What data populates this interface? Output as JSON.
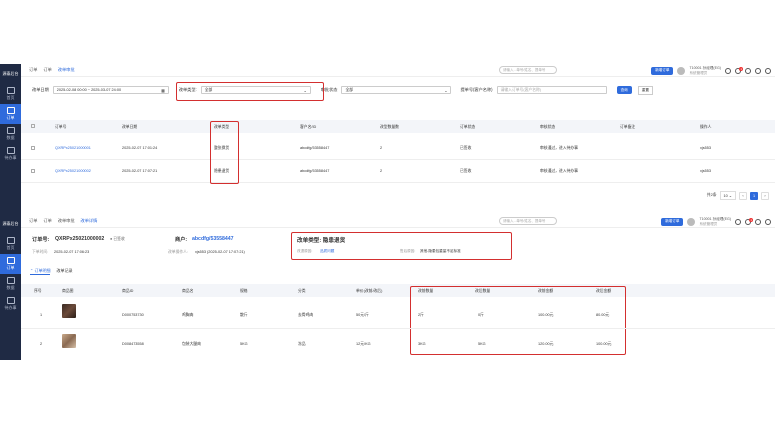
{
  "app": {
    "logo": "源泰后台"
  },
  "sidebar": {
    "items": [
      {
        "label": "首页"
      },
      {
        "label": "订单"
      },
      {
        "label": "数据"
      },
      {
        "label": "待办事"
      }
    ]
  },
  "top1": {
    "crumbs": [
      "订单",
      "订单",
      "改单审批"
    ],
    "search_placeholder": "请输入...单号/姓名、提单号",
    "btn": "新增订单",
    "user_name": "T10001 孙经理(EG)",
    "user_sub": "系统管理员"
  },
  "filters": {
    "date_label": "改单日期",
    "date_value": "2025-02-08 00:00 ~ 2025-03-07 24:00",
    "type_label": "改单类型:",
    "type_value": "全部",
    "audit_label": "审批状态",
    "audit_value": "全部",
    "order_label": "提单号(客户名称)",
    "order_placeholder": "请输入订单号(客户名称)",
    "search_btn": "查询",
    "reset_btn": "重置"
  },
  "list": {
    "headers": [
      "订单号",
      "改单日期",
      "改单类型",
      "客户名/ID",
      "改型数量数",
      "订单状态",
      "审核状态",
      "订单备注",
      "操作人"
    ],
    "rows": [
      {
        "order": "QXRPx25021000001",
        "date": "2025-02-07 17:01:24",
        "type": "整张换货",
        "customer": "abcdfg/53558447",
        "qty": "2",
        "status": "已签收",
        "audit": "审核通过，进入待办事",
        "remark": "",
        "op": "xjs553"
      },
      {
        "order": "QXRPx25021000002",
        "date": "2025-02-07 17:07:21",
        "type": "隐患退货",
        "customer": "abcdfg/53558447",
        "qty": "2",
        "status": "已签收",
        "audit": "审核通过，进入待办事",
        "remark": "",
        "op": "xjs553"
      }
    ],
    "pager": {
      "total": "共2条",
      "size": "10",
      "page": "1"
    }
  },
  "top2": {
    "crumbs": [
      "订单",
      "订单",
      "改单审批",
      "改单详情"
    ],
    "search_placeholder": "请输入...单号/姓名、提单号",
    "btn": "新增订单",
    "user_name": "T10001 孙经理(EG)",
    "user_sub": "系统管理员"
  },
  "detail": {
    "order_label": "订单号:",
    "order_no": "QXRPx25021000002",
    "status": "● 已签收",
    "customer_label": "商户:",
    "customer": "abcdfg/53558447",
    "meta1_label": "下单时间:",
    "meta1": "2025-02-07 17:06:23",
    "meta2_label": "改单操作人:",
    "meta2": "xjs553 (2025-02-07 17:07:21)",
    "type_title": "改单类型: 隐患退货",
    "type_sub_label": "改退原因:",
    "type_sub": "品质问题",
    "type_sub2_label": "售后原因:",
    "type_sub2": "其他-隐患包重量不足标准",
    "tabs": [
      "订单明细",
      "改单记录"
    ],
    "headers": [
      "序号",
      "商品图",
      "商品ID",
      "商品名",
      "规格",
      "分类",
      "单价(改前/改后)",
      "改前数量",
      "改后数量",
      "改前金额",
      "改后金额"
    ],
    "rows": [
      {
        "idx": "1",
        "id": "D000753730",
        "name": "鸡胸肉",
        "spec": "散斤",
        "cat": "去骨鸡肉",
        "price": "50元/斤",
        "q1": "2斤",
        "q2": "0斤",
        "a1": "100.00元",
        "a2": "80.00元"
      },
      {
        "idx": "2",
        "id": "D008473558",
        "name": "包装大腿肉",
        "spec": "5KG",
        "cat": "冻品",
        "price": "12元/KG",
        "q1": "3KG",
        "q2": "5KG",
        "a1": "120.00元",
        "a2": "100.00元"
      }
    ]
  },
  "colors": {
    "sidebar": "#1f2a44",
    "accent": "#2f6bdc",
    "highlight": "#d32f2f"
  }
}
